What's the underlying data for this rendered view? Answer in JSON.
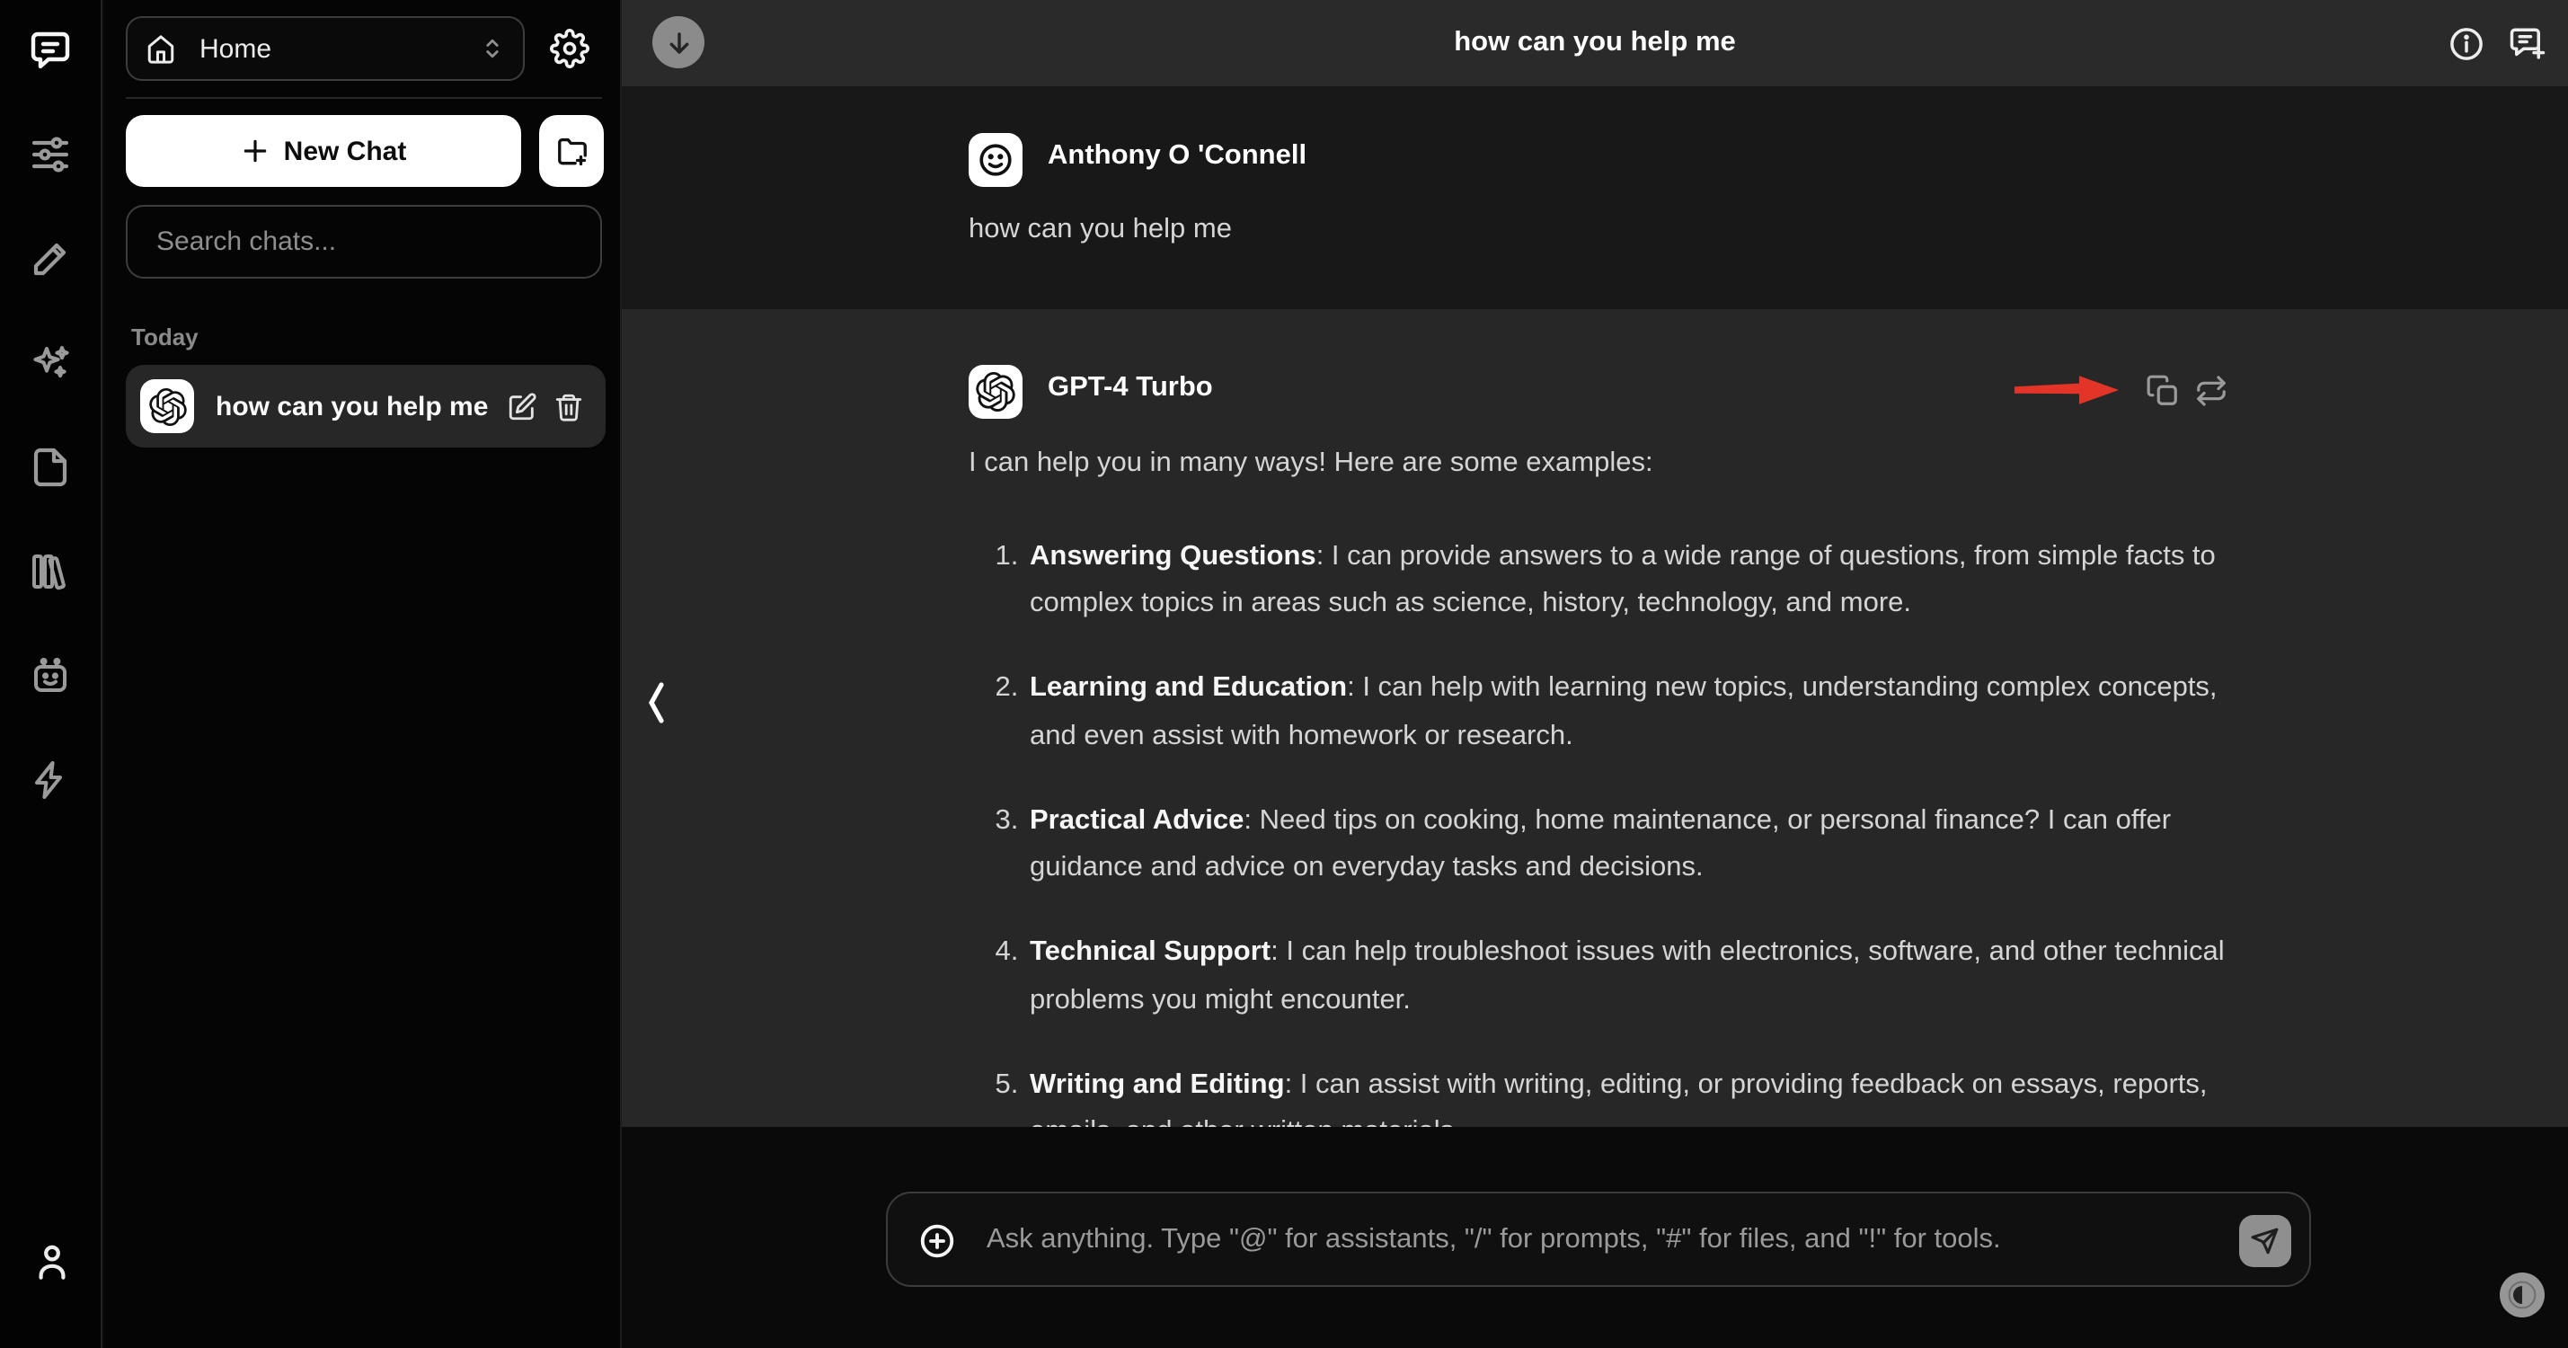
{
  "colors": {
    "annotation_red": "#e23527",
    "accent_white": "#ffffff"
  },
  "rail": {
    "icons": [
      "chat-icon",
      "sliders-icon",
      "pencil-icon",
      "sparkles-icon",
      "file-icon",
      "library-icon",
      "bot-icon",
      "zap-icon"
    ],
    "profile_icon": "person-icon"
  },
  "sidebar": {
    "workspace_label": "Home",
    "new_chat_label": "New Chat",
    "search_placeholder": "Search chats...",
    "section_label": "Today",
    "conversations": [
      {
        "title": "how can you help me"
      }
    ]
  },
  "header": {
    "title": "how can you help me"
  },
  "messages": {
    "user": {
      "name": "Anthony O 'Connell",
      "text": "how can you help me"
    },
    "assistant": {
      "name": "GPT-4 Turbo",
      "intro": "I can help you in many ways! Here are some examples:",
      "items": [
        {
          "label": "Answering Questions",
          "text": ": I can provide answers to a wide range of questions, from simple facts to complex topics in areas such as science, history, technology, and more."
        },
        {
          "label": "Learning and Education",
          "text": ": I can help with learning new topics, understanding complex concepts, and even assist with homework or research."
        },
        {
          "label": "Practical Advice",
          "text": ": Need tips on cooking, home maintenance, or personal finance? I can offer guidance and advice on everyday tasks and decisions."
        },
        {
          "label": "Technical Support",
          "text": ": I can help troubleshoot issues with electronics, software, and other technical problems you might encounter."
        },
        {
          "label": "Writing and Editing",
          "text": ": I can assist with writing, editing, or providing feedback on essays, reports, emails, and other written materials."
        }
      ]
    }
  },
  "composer": {
    "placeholder": "Ask anything. Type \"@\" for assistants, \"/\" for prompts, \"#\" for files, and \"!\" for tools."
  }
}
